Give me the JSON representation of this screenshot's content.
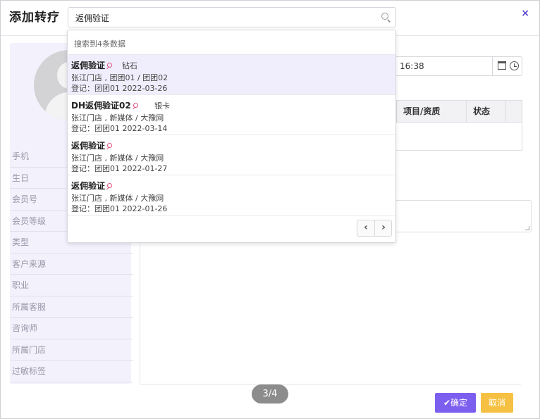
{
  "dialog": {
    "title": "添加转疗",
    "close_label": "×"
  },
  "search": {
    "value": "返佣验证"
  },
  "dropdown": {
    "count_text": "搜索到4条数据",
    "items": [
      {
        "name": "返佣验证",
        "level": "钻石",
        "line2": "张江门店 , 团团01 / 团团02",
        "line3": "登记：团团01  2022-03-26"
      },
      {
        "name": "DH返佣验证02",
        "level": "银卡",
        "line2": "张江门店 , 新媒体 / 大豫网",
        "line3": "登记：团团01  2022-03-14"
      },
      {
        "name": "返佣验证",
        "level": "",
        "line2": "张江门店 , 新媒体 / 大豫网",
        "line3": "登记：团团01  2022-01-27"
      },
      {
        "name": "返佣验证",
        "level": "",
        "line2": "张江门店 , 新媒体 / 大豫网",
        "line3": "登记：团团01  2022-01-26"
      }
    ],
    "prev": "‹",
    "next": "›"
  },
  "profile": {
    "fields": [
      "手机",
      "生日",
      "会员号",
      "会员等级",
      "类型",
      "客户来源",
      "职业",
      "所属客服",
      "咨询师",
      "所属门店",
      "过敏标签"
    ]
  },
  "datetime": {
    "value": "16:38"
  },
  "table": {
    "headers": [
      "项目/资质",
      "状态"
    ]
  },
  "pager_pill": "3/4",
  "buttons": {
    "ok": "✔确定",
    "cancel": "取消"
  },
  "colors": {
    "accent": "#7d5ff0",
    "cancel": "#f6c142",
    "panel": "#f3f1fc"
  }
}
